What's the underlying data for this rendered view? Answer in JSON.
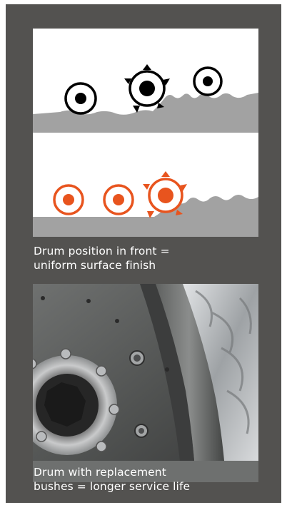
{
  "panel": {
    "background_color": "#535250",
    "figures": [
      {
        "name": "drum-position-diagram",
        "caption_lines": [
          "Drum position in front =",
          "uniform surface finish"
        ],
        "rows": [
          {
            "surface_color": "#a2a2a2",
            "drum_color": "#000000",
            "drum_count": 3
          },
          {
            "surface_color": "#a2a2a2",
            "drum_color": "#e8541e",
            "drum_count": 3
          }
        ]
      },
      {
        "name": "drum-photo",
        "caption_lines": [
          "Drum with replacement",
          "bushes = longer service life"
        ]
      }
    ],
    "caption_color": "#ffffff"
  }
}
